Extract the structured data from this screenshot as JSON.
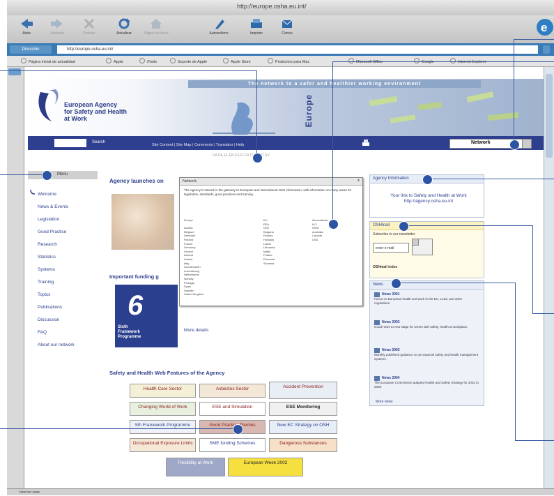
{
  "window": {
    "title": "http://europe.osha.eu.int/"
  },
  "toolbar": {
    "buttons": [
      {
        "label": "Atrás",
        "icon": "back-arrow-icon",
        "enabled": true
      },
      {
        "label": "Adelante",
        "icon": "forward-arrow-icon",
        "enabled": false
      },
      {
        "label": "Detener",
        "icon": "stop-icon",
        "enabled": false
      },
      {
        "label": "Actualizar",
        "icon": "refresh-icon",
        "enabled": true
      },
      {
        "label": "Página de inicio",
        "icon": "home-icon",
        "enabled": false
      },
      {
        "label": "Autorrelleno",
        "icon": "autofill-icon",
        "enabled": true
      },
      {
        "label": "Imprimir",
        "icon": "print-icon",
        "enabled": true
      },
      {
        "label": "Correo",
        "icon": "mail-icon",
        "enabled": true
      }
    ]
  },
  "addressbar": {
    "label": "Dirección",
    "url": "http://europe.osha.eu.int/"
  },
  "favorites": [
    "Página inicial de actualidad",
    "Apple",
    "iTools",
    "Soporte de Apple",
    "Apple Store",
    "Productos para Mac",
    "Microsoft Office",
    "Google",
    "Internet Explorer"
  ],
  "status": {
    "text": "Internet zone"
  },
  "site": {
    "tagline": "The network to a safer and healthier working environment",
    "logo_lines": [
      "European Agency",
      "for Safety and Health",
      "at Work"
    ],
    "europe_label": "Europe",
    "search_label": "Search",
    "nav_links": "Site Content | Site Map | Comments | Translator | Help",
    "network_select": "Network",
    "languages": "DA DE EL EN ES FI FR IT NL PT SV"
  },
  "menu": {
    "header": "Menu",
    "items": [
      "Welcome",
      "News & Events",
      "Legislation",
      "Good Practice",
      "Research",
      "Statistics",
      "Systems",
      "Training",
      "Topics",
      "Publications",
      "Discussion",
      "FAQ",
      "About our network"
    ]
  },
  "content": {
    "headline": "Agency launches on",
    "important_heading": "Important funding g",
    "fp6_number": "6",
    "fp6_text": [
      "Sixth",
      "Framework",
      "Programme"
    ],
    "more_details": "More details",
    "web_features_heading": "Safety and Health Web Features of the Agency",
    "features": [
      "Health Care Sector",
      "Asbestos Sector",
      "Accident Prevention",
      "Changing World of Work",
      "ESE and Simulation",
      "ESE Monitoring",
      "5th Framework Programme",
      "Good Practice Themes",
      "New EC Strategy on OSH",
      "Occupational Exposure Limits",
      "SME funding Schemes",
      "Dangerous Substances",
      "Flexibility at Work",
      "European Week 2002"
    ]
  },
  "popup": {
    "title": "Network",
    "close": "x",
    "text": "The Agency's network is the gateway to European and international OSH information, with information on many areas for legislation, standards, good practices and training.",
    "countries_col1": [
      "Europe",
      "",
      "Austria",
      "Belgium",
      "Denmark",
      "Finland",
      "France",
      "Germany",
      "Greece",
      "Iceland",
      "Ireland",
      "Italy",
      "Liechtenstein",
      "Luxembourg",
      "Netherlands",
      "Norway",
      "Portugal",
      "Spain",
      "Sweden",
      "United Kingdom"
    ],
    "countries_col2": [
      "EU",
      "EEA",
      "CEE",
      "Bulgaria",
      "Estonia",
      "Hungary",
      "Latvia",
      "Lithuania",
      "Malta",
      "Poland",
      "Romania",
      "Slovenia"
    ],
    "countries_col3": [
      "International",
      "ILO",
      "WHO",
      "Australia",
      "Canada",
      "USA"
    ]
  },
  "right": {
    "agency_header": "Agency Information",
    "agency_text": "Your link to Safety and Health at Work http://agency.osha.eu.int",
    "osha_header": "OSHmail",
    "osha_intro": "Subscribe to our newsletter",
    "osha_input": "enter e-mail",
    "osha_footer": "OSHmail index",
    "news_header": "News",
    "news": [
      {
        "title": "News 2001",
        "text": "Focus on European health and work in the EU, Lead, and other regulations."
      },
      {
        "title": "News 2002",
        "text": "Good news to new stage for OSHA with safety, health at workplace."
      },
      {
        "title": "News 2003",
        "text": "Monthly published guidance on an especial safety and health management systems."
      },
      {
        "title": "News 2004",
        "text": "The European Commission adopted Health and Safety Strategy for 2002 to 2006."
      }
    ],
    "news_more": "More news"
  },
  "colors": {
    "navy": "#2f3f8f",
    "callout": "#2d53a3",
    "link": "#2c3f8c"
  }
}
